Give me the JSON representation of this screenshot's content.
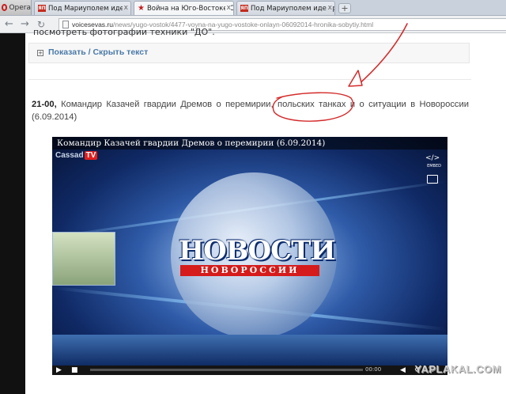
{
  "browser": {
    "menu_label": "Opera",
    "tabs": [
      {
        "favicon": "ЯП",
        "title": "Под Мариуполем идет р",
        "active": false
      },
      {
        "favicon": "star",
        "title": "Война на Юго-Востоке С",
        "active": true
      },
      {
        "favicon": "ЯП",
        "title": "Под Мариуполем идет р",
        "active": false
      }
    ],
    "close_glyph": "x",
    "new_tab_glyph": "+",
    "address": {
      "domain": "voicesevas.ru",
      "path": "/news/yugo-vostok/4477-voyna-na-yugo-vostoke-onlayn-06092014-hronika-sobytiy.html"
    }
  },
  "article": {
    "cut_text": "посмотреть фотографии техники \"ДО\".",
    "spoiler": {
      "plus": "+",
      "label": "Показать / Скрыть текст"
    },
    "entry": {
      "time": "21-00,",
      "text_before": " Командир Казачей гвардии Дремов о перемирии, ",
      "highlight": "польских танках",
      "text_after": " и о ситуации в Новороссии (6.09.2014)"
    }
  },
  "video": {
    "title": "Командир Казачей гвардии Дремов о перемирии (6.09.2014)",
    "channel": "Cassad",
    "channel_tv": "TV",
    "embed_label": "EMBED",
    "logo_main": "НОВОСТИ",
    "logo_sub": "НОВОРОССИИ",
    "progress": 0,
    "time": "00:00"
  },
  "watermark": "YAPLAKAL.COM",
  "colors": {
    "annotation": "#d42a2a",
    "link": "#4a79a8",
    "logo_red": "#d51b1b"
  }
}
